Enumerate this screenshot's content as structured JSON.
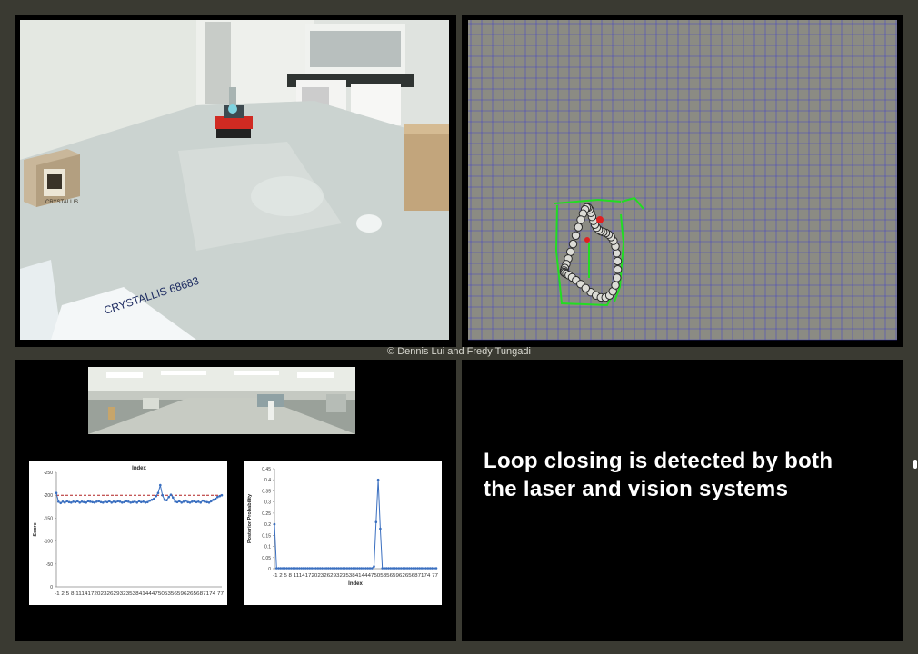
{
  "caption": "© Dennis Lui and Fredy Tungadi",
  "message": {
    "line1": "Loop closing is detected by both",
    "line2": "the laser and vision systems"
  },
  "video_scene": {
    "box_label": "CRYSTALLIS",
    "marker_text": "CRYSTALLIS 68683"
  },
  "colors": {
    "map_background": "#8b8b83",
    "grid": "#3b3bd0",
    "laser_scan": "#22dd22",
    "loop_pose": "#e02020",
    "series_marker": "#3a6fc0",
    "threshold": "#b02020"
  },
  "chart_data": [
    {
      "type": "line",
      "title": "Index",
      "xlabel": "",
      "ylabel": "Score",
      "ylim": [
        -250,
        0
      ],
      "y_ticks": [
        "-250",
        "-200",
        "-150",
        "-100",
        "-50",
        "0"
      ],
      "x_tick_text": "-1 2 5 8 11141720232629323538414447505356596265687174 77",
      "threshold": -200,
      "values": [
        -205,
        -186,
        -183,
        -186,
        -184,
        -187,
        -185,
        -184,
        -186,
        -185,
        -187,
        -184,
        -186,
        -185,
        -184,
        -187,
        -186,
        -185,
        -184,
        -186,
        -187,
        -185,
        -184,
        -186,
        -185,
        -187,
        -184,
        -186,
        -185,
        -187,
        -186,
        -184,
        -185,
        -187,
        -186,
        -184,
        -185,
        -186,
        -184,
        -187,
        -185,
        -186,
        -184,
        -185,
        -188,
        -190,
        -192,
        -198,
        -205,
        -222,
        -200,
        -190,
        -189,
        -196,
        -201,
        -195,
        -186,
        -185,
        -187,
        -184,
        -186,
        -188,
        -185,
        -184,
        -186,
        -187,
        -185,
        -186,
        -184,
        -188,
        -186,
        -185,
        -184,
        -187,
        -190,
        -192,
        -196,
        -198,
        -200
      ]
    },
    {
      "type": "line",
      "title": "",
      "xlabel": "Index",
      "ylabel": "Posterior Probability",
      "ylim": [
        0,
        0.45
      ],
      "y_ticks": [
        "0.45",
        "0.4",
        "0.35",
        "0.3",
        "0.25",
        "0.2",
        "0.15",
        "0.1",
        "0.05",
        "0"
      ],
      "x_tick_text": "-1 2 5 8 11141720232629323538414447505356596265687174 77",
      "values": [
        0.2,
        0.002,
        0.002,
        0.002,
        0.002,
        0.002,
        0.002,
        0.002,
        0.002,
        0.002,
        0.002,
        0.002,
        0.002,
        0.002,
        0.002,
        0.002,
        0.002,
        0.002,
        0.002,
        0.002,
        0.002,
        0.002,
        0.002,
        0.002,
        0.002,
        0.002,
        0.002,
        0.002,
        0.002,
        0.002,
        0.002,
        0.002,
        0.002,
        0.002,
        0.002,
        0.002,
        0.002,
        0.002,
        0.002,
        0.002,
        0.002,
        0.002,
        0.002,
        0.002,
        0.002,
        0.002,
        0.002,
        0.002,
        0.01,
        0.21,
        0.4,
        0.18,
        0.002,
        0.002,
        0.002,
        0.002,
        0.002,
        0.002,
        0.002,
        0.002,
        0.002,
        0.002,
        0.002,
        0.002,
        0.002,
        0.002,
        0.002,
        0.002,
        0.002,
        0.002,
        0.002,
        0.002,
        0.002,
        0.002,
        0.002,
        0.002,
        0.002,
        0.002,
        0.002
      ]
    }
  ]
}
